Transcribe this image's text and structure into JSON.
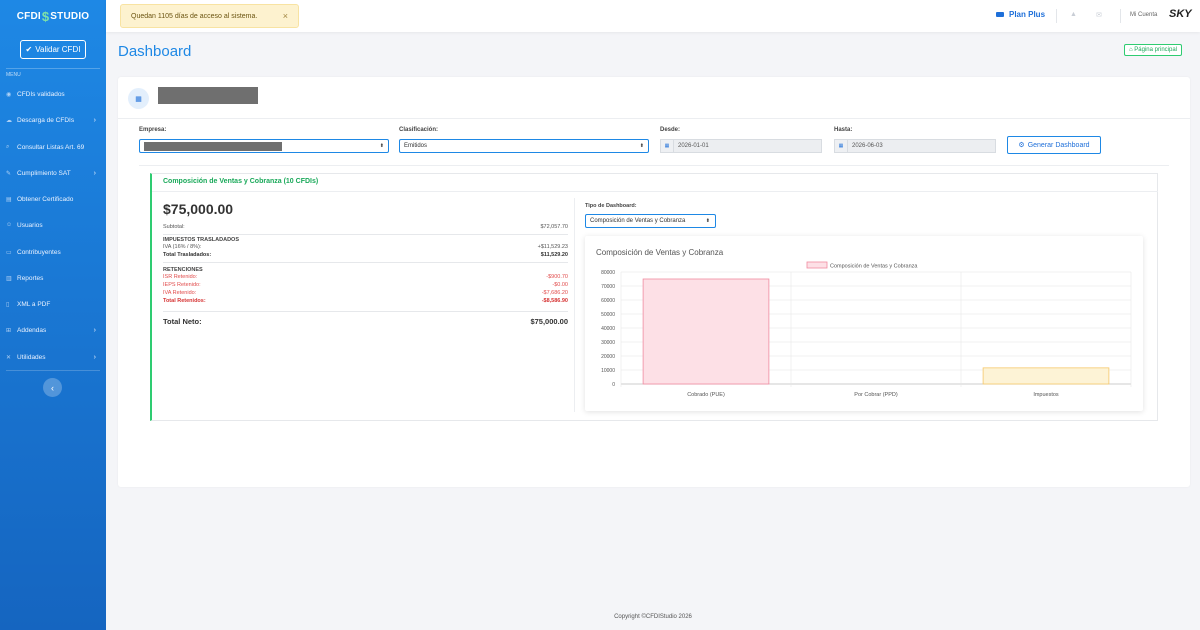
{
  "sidebar": {
    "brand_left": "CFDI",
    "brand_symbol": "$",
    "brand_right": "STUDIO",
    "validar_label": "Validar CFDI",
    "menu_title": "MENU",
    "items": [
      {
        "label": "CFDIs validados",
        "icon": "check-circle-icon",
        "has_children": false
      },
      {
        "label": "Descarga de CFDIs",
        "icon": "cloud-download-icon",
        "has_children": true
      },
      {
        "label": "Consultar Listas Art. 69",
        "icon": "search-icon",
        "has_children": false
      },
      {
        "label": "Cumplimiento SAT",
        "icon": "wrench-icon",
        "has_children": true
      },
      {
        "label": "Obtener Certificado",
        "icon": "certificate-icon",
        "has_children": false
      },
      {
        "label": "Usuarios",
        "icon": "users-icon",
        "has_children": false
      },
      {
        "label": "Contribuyentes",
        "icon": "id-card-icon",
        "has_children": false
      },
      {
        "label": "Reportes",
        "icon": "report-icon",
        "has_children": false
      },
      {
        "label": "XML a PDF",
        "icon": "file-icon",
        "has_children": false
      },
      {
        "label": "Addendas",
        "icon": "cart-icon",
        "has_children": true
      },
      {
        "label": "Utilidades",
        "icon": "tools-icon",
        "has_children": true
      }
    ],
    "collapse_icon": "‹"
  },
  "topbar": {
    "alert_text": "Quedan 1105 días de acceso al sistema.",
    "alert_close": "×",
    "plan_label": "Plan Plus",
    "account_label": "Mi Cuenta",
    "logo_text": "SKY"
  },
  "page": {
    "title": "Dashboard",
    "home_button": "Página principal"
  },
  "filters": {
    "empresa_label": "Empresa:",
    "clasificacion_label": "Clasificación:",
    "clasificacion_value": "Emitidos",
    "desde_label": "Desde:",
    "desde_value": "2026-01-01",
    "hasta_label": "Hasta:",
    "hasta_value": "2026-06-03",
    "generate_button": "Generar Dashboard"
  },
  "summary": {
    "card_title": "Composición de Ventas y Cobranza (10 CFDIs)",
    "total": "$75,000.00",
    "subtotal_label": "Subtotal:",
    "subtotal_value": "$72,057.70",
    "traslados_header": "IMPUESTOS TRASLADADOS",
    "iva_label": "IVA (16% / 8%):",
    "iva_value": "+$11,529.23",
    "total_traslados_label": "Total Trasladados:",
    "total_traslados_value": "$11,529.20",
    "retenciones_header": "RETENCIONES",
    "isr_label": "ISR Retenido:",
    "isr_value": "-$900.70",
    "ieps_label": "IEPS Retenido:",
    "ieps_value": "-$0.00",
    "iva_ret_label": "IVA Retenido:",
    "iva_ret_value": "-$7,686.20",
    "total_ret_label": "Total Retenidos:",
    "total_ret_value": "-$8,586.90",
    "neto_label": "Total Neto:",
    "neto_value": "$75,000.00"
  },
  "dashboard_type": {
    "label": "Tipo de Dashboard:",
    "value": "Composición de Ventas y Cobranza"
  },
  "chart_data": {
    "type": "bar",
    "title": "Composición de Ventas y Cobranza",
    "categories": [
      "Cobrado (PUE)",
      "Por Cobrar (PPD)",
      "Impuestos"
    ],
    "series": [
      {
        "name": "Composición de Ventas y Cobranza",
        "values": [
          75000,
          0,
          11529.2
        ]
      }
    ],
    "colors": {
      "fill": [
        "#fde0e6",
        "#fde0e6",
        "#fdf3d6"
      ],
      "stroke": [
        "#f08aa0",
        "#f08aa0",
        "#f5c76a"
      ]
    },
    "ylim": [
      0,
      80000
    ],
    "yticks": [
      "80000",
      "70000",
      "60000",
      "50000",
      "40000",
      "30000",
      "20000",
      "10000",
      "0"
    ],
    "legend": "top",
    "grid": true
  },
  "footer": {
    "copyright": "Copyright ©CFDIStudio 2026"
  }
}
